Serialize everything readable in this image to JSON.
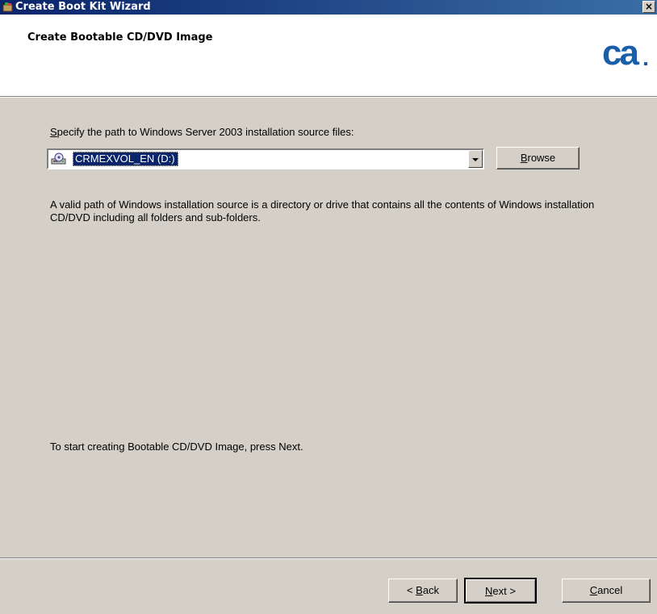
{
  "window": {
    "title": "Create Boot Kit Wizard",
    "close_label": "×"
  },
  "header": {
    "heading": "Create Bootable CD/DVD Image",
    "logo_text": "ca",
    "logo_color": "#1a5da8"
  },
  "source": {
    "label_prefix": "S",
    "label_rest": "pecify the path to Windows Server 2003 installation source files:",
    "selected_value": "CRMEXVOL_EN (D:)",
    "browse_label_prefix": "B",
    "browse_label_rest": "rowse"
  },
  "description": "A valid path of Windows installation source is a directory or drive that contains all the contents of Windows installation CD/DVD including all folders and sub-folders.",
  "hint": "To start creating Bootable CD/DVD Image, press Next.",
  "buttons": {
    "back_pre": "< ",
    "back_key": "B",
    "back_rest": "ack",
    "next_key": "N",
    "next_rest": "ext >",
    "cancel_key": "C",
    "cancel_rest": "ancel"
  },
  "icons": {
    "app": "wizard-app-icon",
    "drive": "cd-drive-icon",
    "dropdown": "chevron-down-icon",
    "close": "close-icon"
  }
}
